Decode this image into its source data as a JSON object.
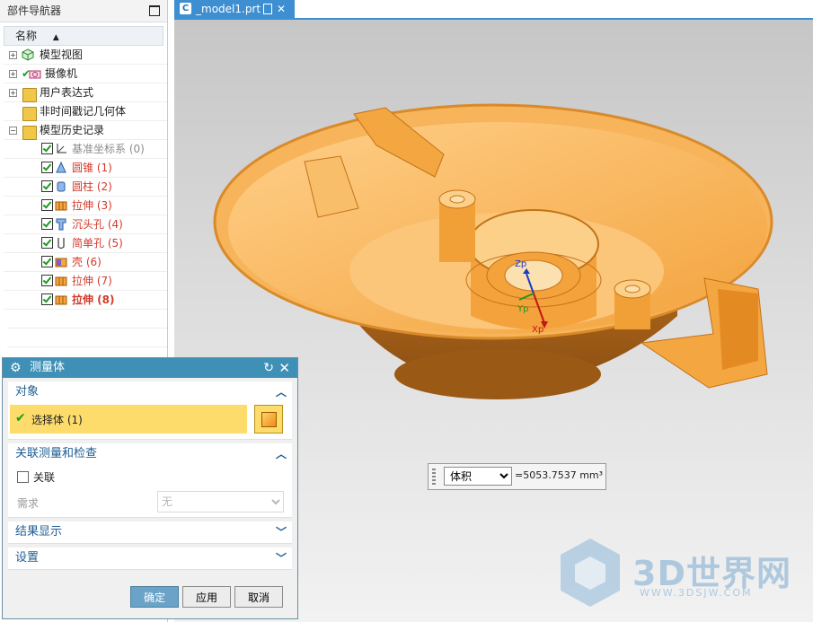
{
  "navigator": {
    "title": "部件导航器",
    "column_name": "名称",
    "items": [
      {
        "label": "模型视图",
        "level": 0,
        "icon": "model-views-icon"
      },
      {
        "label": "摄像机",
        "level": 0,
        "icon": "camera-icon"
      },
      {
        "label": "用户表达式",
        "level": 0,
        "icon": "folder-icon"
      },
      {
        "label": "非时间戳记几何体",
        "level": 0,
        "icon": "folder-icon"
      },
      {
        "label": "模型历史记录",
        "level": 0,
        "icon": "folder-icon"
      },
      {
        "label": "基准坐标系 (0)",
        "level": 1,
        "icon": "datum-csys-icon"
      },
      {
        "label": "圆锥 (1)",
        "level": 1,
        "icon": "cone-icon"
      },
      {
        "label": "圆柱 (2)",
        "level": 1,
        "icon": "cylinder-icon"
      },
      {
        "label": "拉伸 (3)",
        "level": 1,
        "icon": "extrude-icon"
      },
      {
        "label": "沉头孔 (4)",
        "level": 1,
        "icon": "counterbore-hole-icon"
      },
      {
        "label": "简单孔 (5)",
        "level": 1,
        "icon": "simple-hole-icon"
      },
      {
        "label": "壳 (6)",
        "level": 1,
        "icon": "shell-icon"
      },
      {
        "label": "拉伸 (7)",
        "level": 1,
        "icon": "extrude-icon"
      },
      {
        "label": "拉伸 (8)",
        "level": 1,
        "icon": "extrude-icon"
      }
    ]
  },
  "tab": {
    "name": "_model1.prt",
    "close": "✕"
  },
  "viewport": {
    "axis_labels": {
      "z": "Zp",
      "y": "Yp",
      "x": "Xp"
    },
    "model_color": "#f5a84a",
    "background_top": "#c6c6c6",
    "background_bottom": "#f2f2f2"
  },
  "readout": {
    "type_selected": "体积",
    "value": "=5053.7537 mm³"
  },
  "dialog": {
    "title": "测量体",
    "sections": {
      "object": {
        "title": "对象",
        "select_label": "选择体 (1)"
      },
      "associative": {
        "title": "关联测量和检查",
        "checkbox_label": "关联",
        "requirement_label": "需求",
        "requirement_value": "无"
      },
      "results": {
        "title": "结果显示"
      },
      "settings": {
        "title": "设置"
      }
    },
    "buttons": {
      "ok": "确定",
      "apply": "应用",
      "cancel": "取消"
    },
    "accent": "#3f90b7"
  },
  "watermark": {
    "brand": "3D世界网",
    "url": "WWW.3DSJW.COM"
  }
}
